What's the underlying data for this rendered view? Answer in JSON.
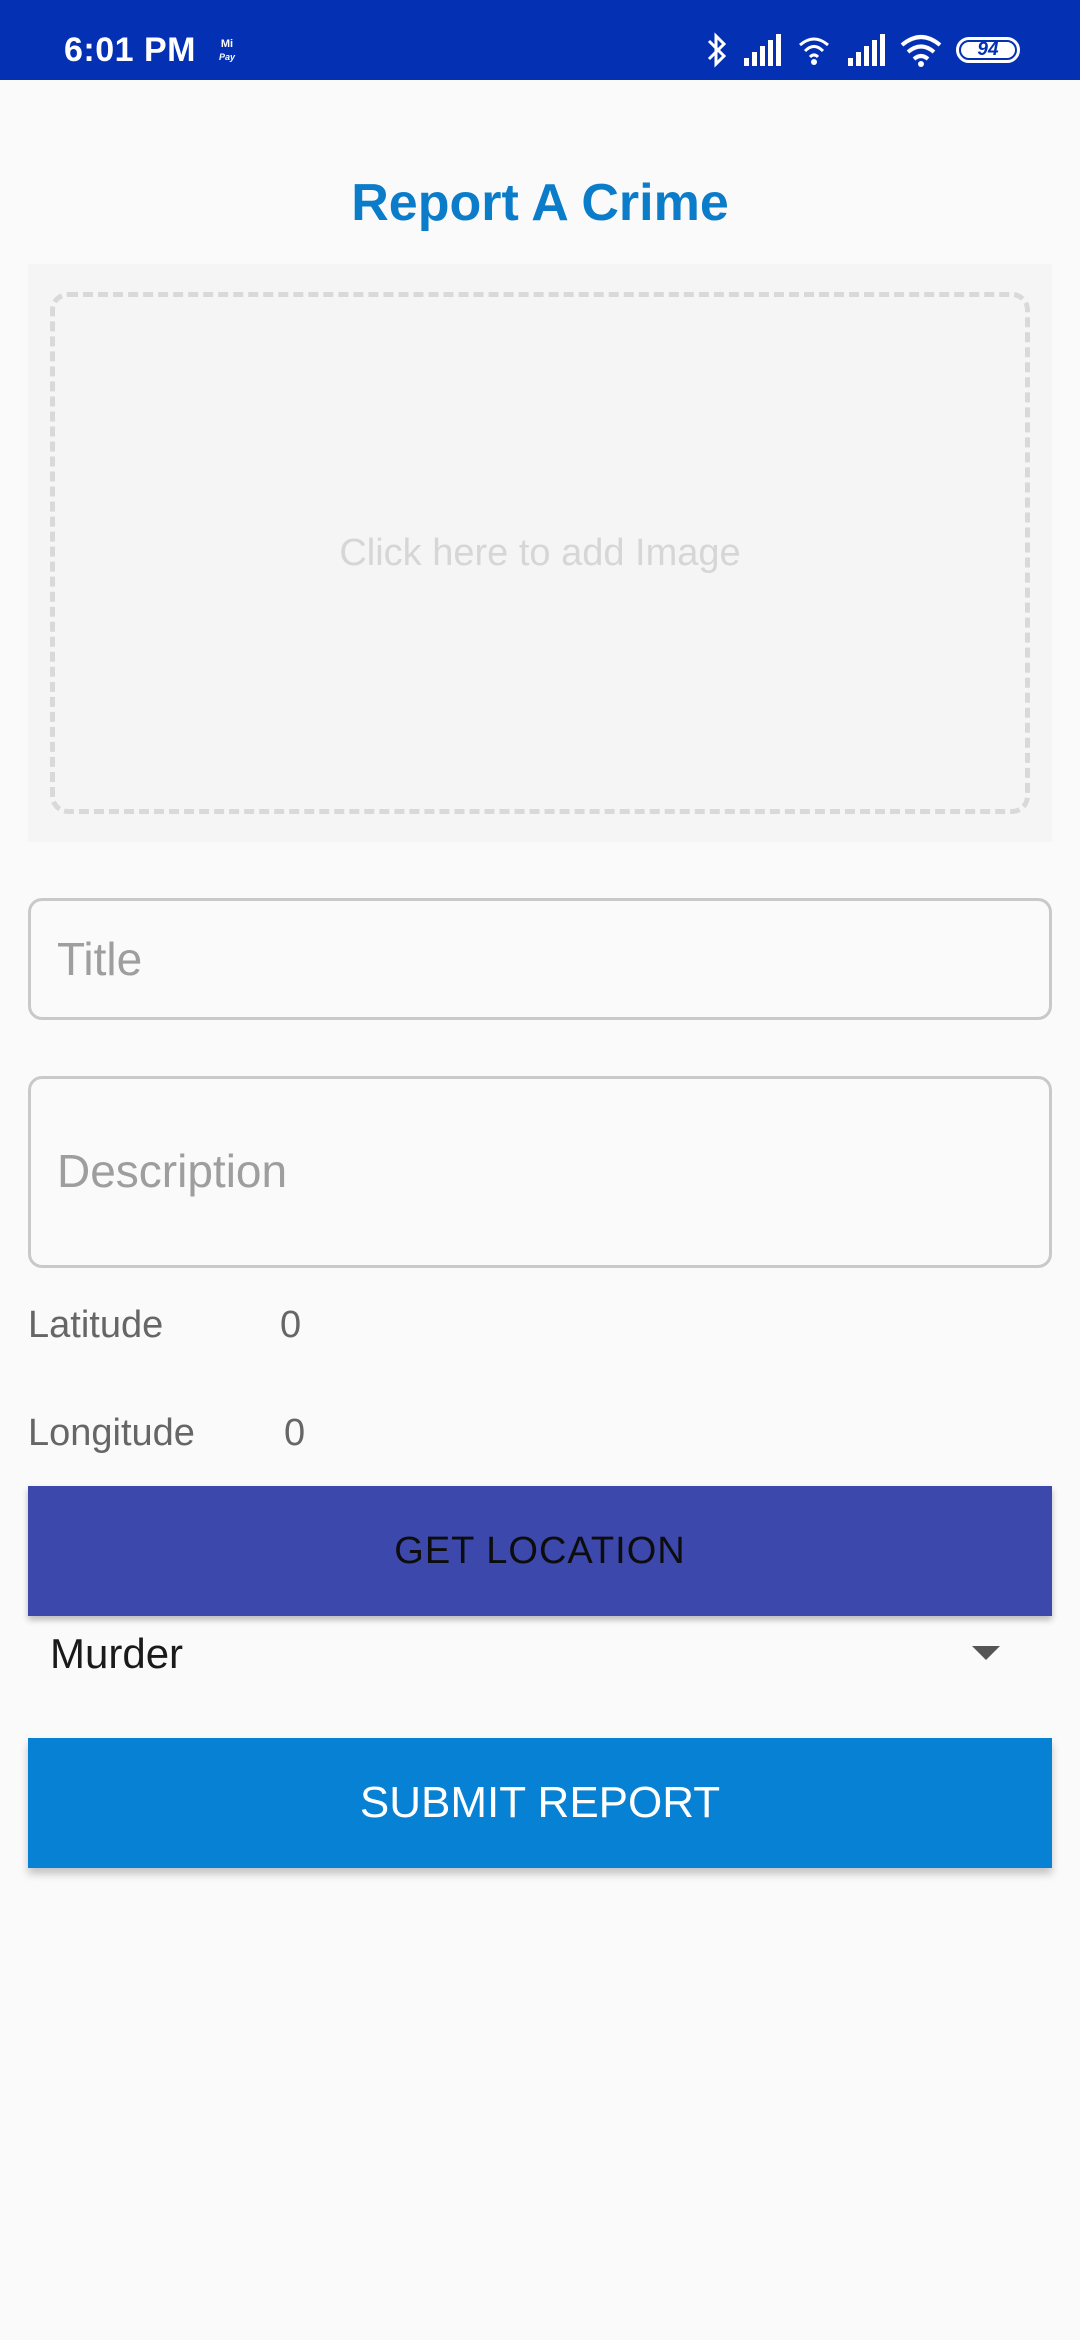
{
  "status_bar": {
    "time": "6:01 PM",
    "pay_icon_text": "Mi Pay",
    "battery_level": "94",
    "icons": [
      "bluetooth-icon",
      "signal-icon",
      "hotspot-icon",
      "signal-icon",
      "wifi-icon",
      "battery-icon"
    ]
  },
  "header": {
    "title": "Report A Crime"
  },
  "image_picker": {
    "hint": "Click here to add Image"
  },
  "form": {
    "title_placeholder": "Title",
    "title_value": "",
    "description_placeholder": "Description",
    "description_value": "",
    "latitude_label": "Latitude",
    "latitude_value": "0",
    "longitude_label": "Longitude",
    "longitude_value": "0",
    "get_location_label": "GET LOCATION",
    "crime_type": "Murder",
    "submit_label": "SUBMIT REPORT"
  },
  "colors": {
    "status_bar": "#0431b4",
    "accent_title": "#0a7cc9",
    "location_button": "#3c48ab",
    "submit_button": "#0681d3",
    "background": "#fafafa"
  }
}
